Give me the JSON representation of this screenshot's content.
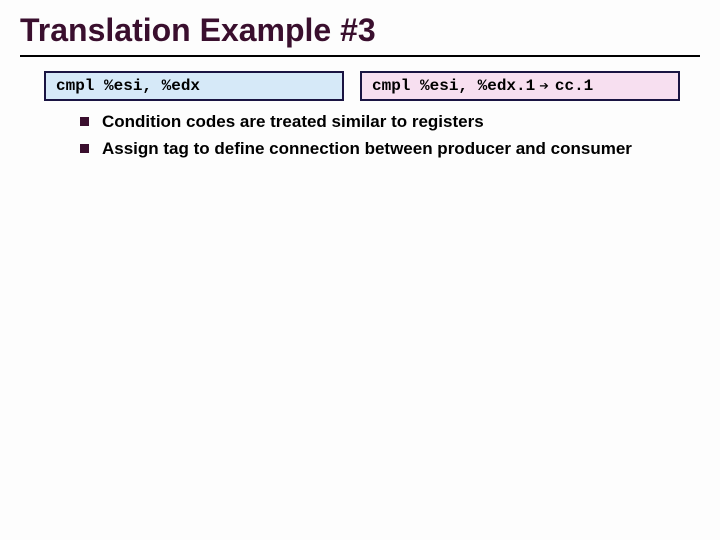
{
  "title": "Translation Example #3",
  "box_left": "cmpl %esi, %edx",
  "box_right": {
    "lhs": "cmpl %esi, %edx.1",
    "arrow": "➔",
    "rhs": "cc.1"
  },
  "bullets": [
    "Condition codes are treated similar to registers",
    "Assign tag to define connection between producer and consumer"
  ]
}
